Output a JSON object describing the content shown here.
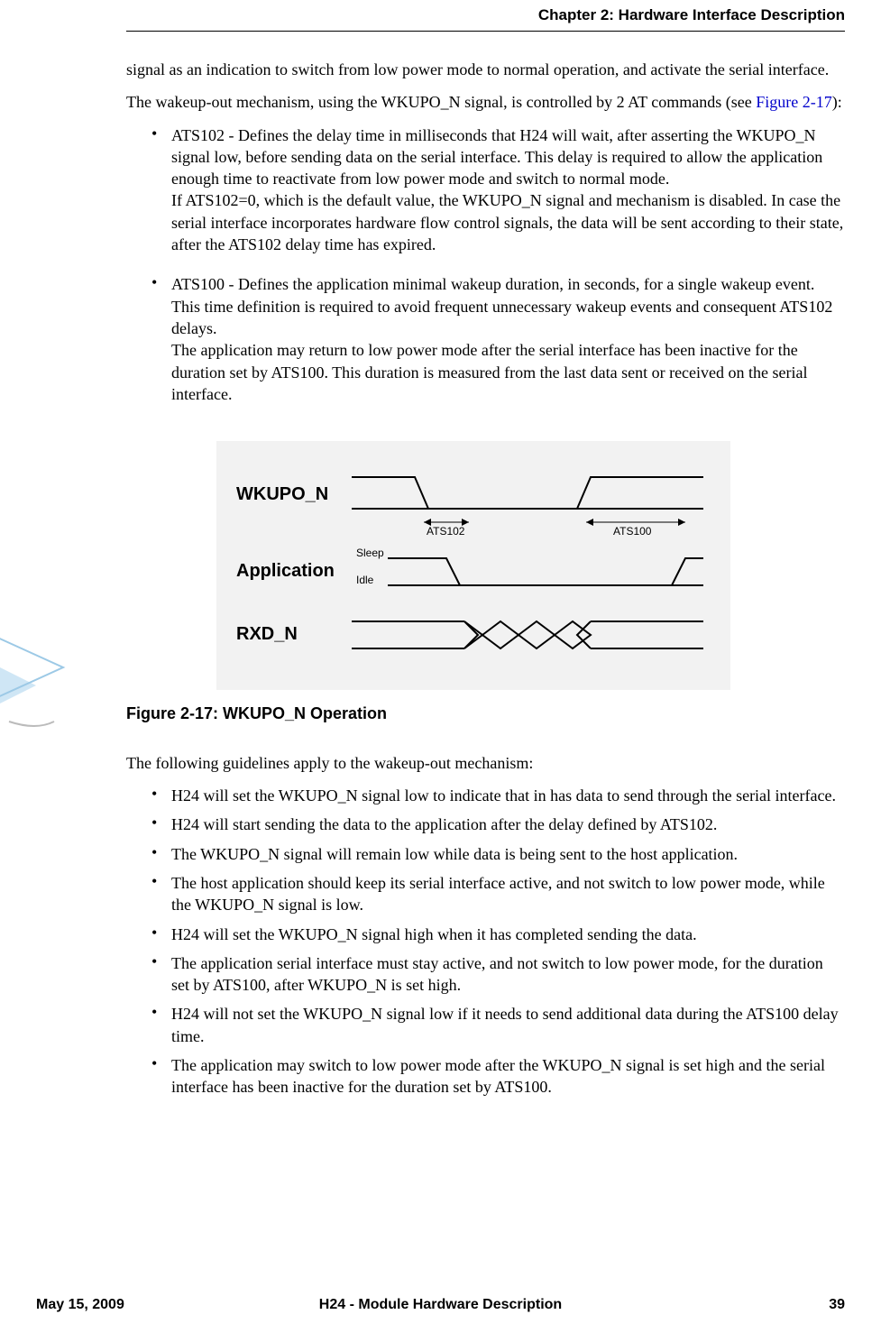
{
  "header": {
    "chapter": "Chapter 2:  Hardware Interface Description"
  },
  "paragraphs": {
    "p1": "signal as an indication to switch from low power mode to normal operation, and activate the serial interface.",
    "p2_pre": "The wakeup-out mechanism, using the WKUPO_N signal, is controlled by 2 AT commands (see ",
    "p2_link": "Figure 2-17",
    "p2_post": "):",
    "b1": "ATS102 - Defines the delay time in milliseconds that H24 will wait, after asserting the WKUPO_N signal low, before sending data on the serial interface. This delay is required to allow the application enough time to reactivate from low power mode and switch to normal mode.\nIf ATS102=0, which is the default value, the WKUPO_N signal and mechanism is disabled. In case the serial interface incorporates hardware flow control signals, the data will be sent according to their state, after the ATS102 delay time has expired.",
    "b2": "ATS100 - Defines the application minimal wakeup duration, in seconds, for a single wakeup event. This time definition is required to avoid frequent unnecessary wakeup events and consequent ATS102 delays.\nThe application may return to low power mode after the serial interface has been inactive for the duration set by ATS100. This duration is measured from the last data sent or received on the serial interface.",
    "guidelines_intro": "The following guidelines apply to the wakeup-out mechanism:",
    "g1": "H24 will set the WKUPO_N signal low to indicate that in has data to send through the serial interface.",
    "g2": "H24 will start sending the data to the application after the delay defined by ATS102.",
    "g3": "The WKUPO_N signal will remain low while data is being sent to the host application.",
    "g4": "The host application should keep its serial interface active, and not switch to low power mode, while the WKUPO_N signal is low.",
    "g5": "H24 will set the WKUPO_N signal high when it has completed sending the data.",
    "g6": "The application serial interface must stay active, and not switch to low power mode, for the duration set by ATS100, after WKUPO_N is set high.",
    "g7": "H24 will not set the WKUPO_N signal low if it needs to send additional data during the ATS100 delay time.",
    "g8": "The application may switch to low power mode after the WKUPO_N signal is set high and the serial interface has been inactive for the duration set by ATS100."
  },
  "figure": {
    "caption": "Figure 2-17: WKUPO_N Operation",
    "labels": {
      "wkupo": "WKUPO_N",
      "app": "Application",
      "rxd": "RXD_N",
      "ats102": "ATS102",
      "ats100": "ATS100",
      "sleep": "Sleep",
      "idle": "Idle"
    }
  },
  "footer": {
    "date": "May 15, 2009",
    "title": "H24 - Module Hardware Description",
    "page": "39"
  }
}
